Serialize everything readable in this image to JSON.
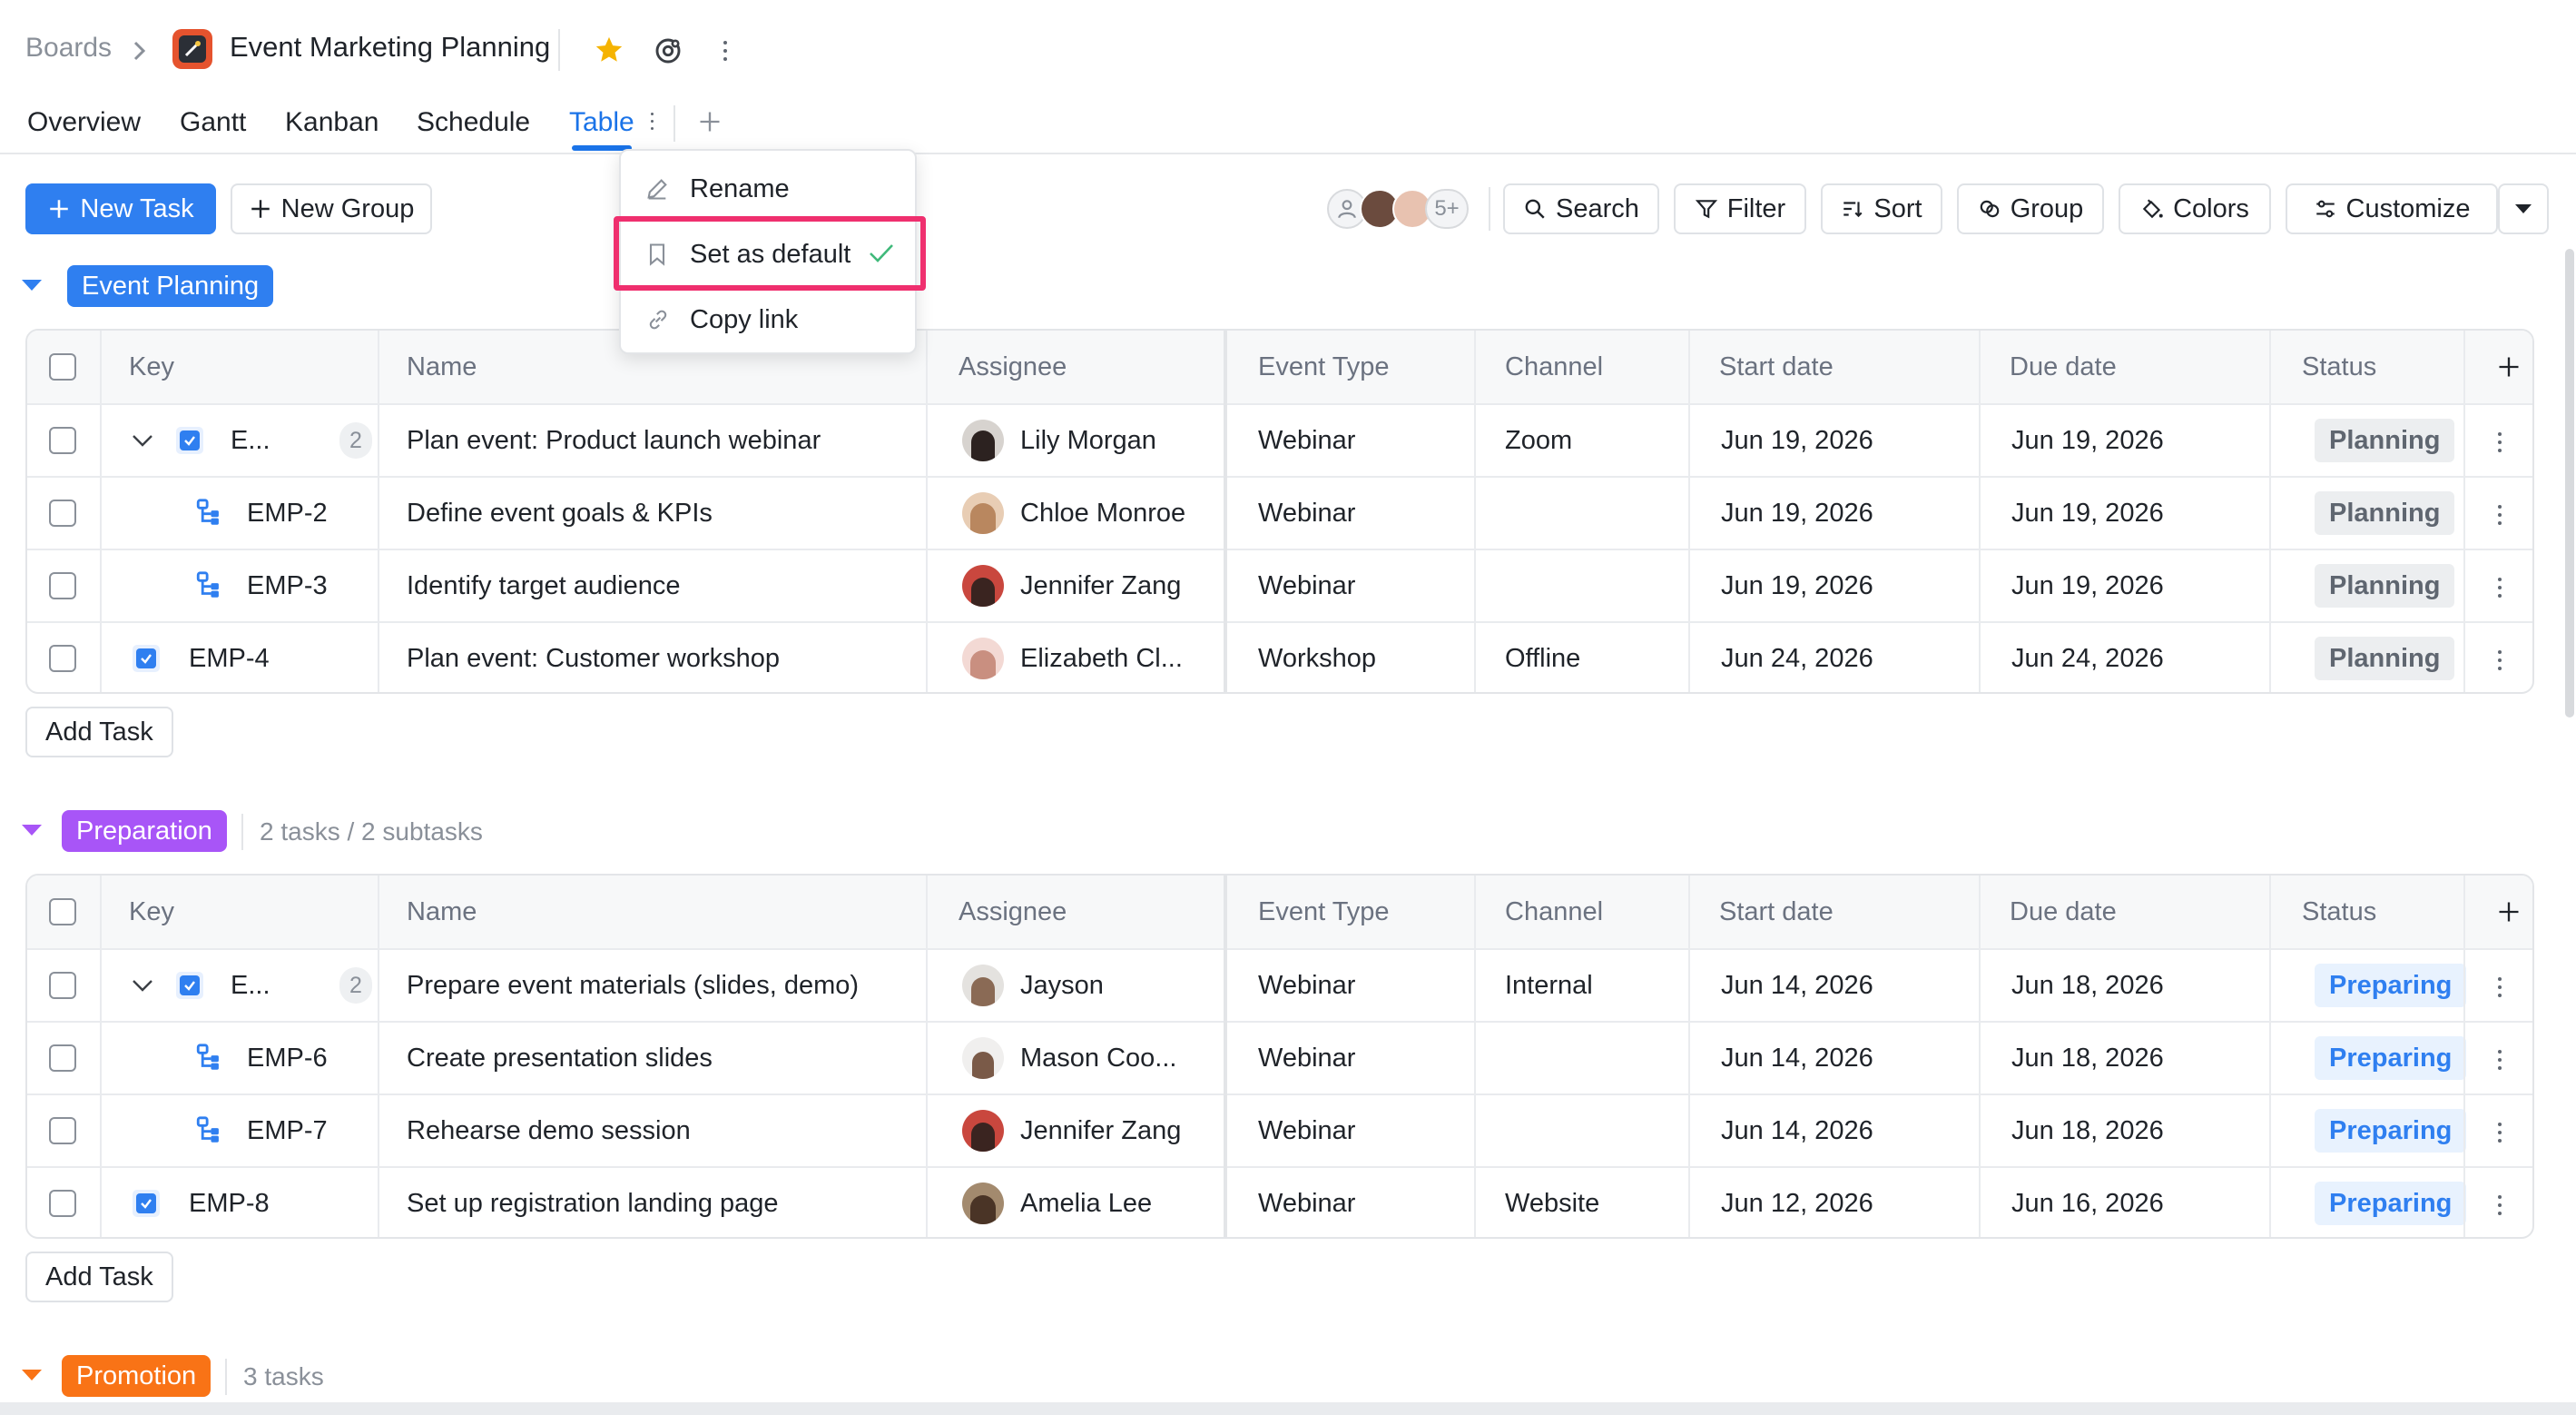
{
  "header": {
    "breadcrumb_root": "Boards",
    "board_title": "Event Marketing Planning",
    "tabs": [
      {
        "label": "Overview"
      },
      {
        "label": "Gantt"
      },
      {
        "label": "Kanban"
      },
      {
        "label": "Schedule"
      },
      {
        "label": "Table",
        "active": true
      }
    ]
  },
  "menu": {
    "items": [
      {
        "label": "Rename",
        "icon": "pencil-icon"
      },
      {
        "label": "Set as default",
        "icon": "bookmark-icon",
        "checked": true
      },
      {
        "label": "Copy link",
        "icon": "link-icon"
      }
    ]
  },
  "toolbar": {
    "new_task": "New Task",
    "new_group": "New Group",
    "members_more": "5+",
    "search": "Search",
    "filter": "Filter",
    "sort": "Sort",
    "group": "Group",
    "colors": "Colors",
    "customize": "Customize"
  },
  "columns": [
    "Key",
    "Name",
    "Assignee",
    "Event Type",
    "Channel",
    "Start date",
    "Due date",
    "Status"
  ],
  "add_task_label": "Add Task",
  "colors": {
    "accent": "#2f7ff0",
    "event_planning": "#2f7ff0",
    "preparation": "#a855f7",
    "promotion": "#f97316",
    "highlight": "#ef2f6e"
  },
  "groups": [
    {
      "name": "Event Planning",
      "count": "",
      "rows": [
        {
          "key": "E...",
          "subcount": "2",
          "type": "parent",
          "name": "Plan event: Product launch webinar",
          "assignee": "Lily Morgan",
          "event_type": "Webinar",
          "channel": "Zoom",
          "start": "Jun 19, 2026",
          "due": "Jun 19, 2026",
          "status": "Planning"
        },
        {
          "key": "EMP-2",
          "type": "subtask",
          "name": "Define event goals & KPIs",
          "assignee": "Chloe Monroe",
          "event_type": "Webinar",
          "channel": "",
          "start": "Jun 19, 2026",
          "due": "Jun 19, 2026",
          "status": "Planning"
        },
        {
          "key": "EMP-3",
          "type": "subtask",
          "name": "Identify target audience",
          "assignee": "Jennifer Zang",
          "event_type": "Webinar",
          "channel": "",
          "start": "Jun 19, 2026",
          "due": "Jun 19, 2026",
          "status": "Planning"
        },
        {
          "key": "EMP-4",
          "type": "task",
          "name": "Plan event: Customer workshop",
          "assignee": "Elizabeth Cl...",
          "event_type": "Workshop",
          "channel": "Offline",
          "start": "Jun 24, 2026",
          "due": "Jun 24, 2026",
          "status": "Planning"
        }
      ]
    },
    {
      "name": "Preparation",
      "count": "2 tasks / 2 subtasks",
      "rows": [
        {
          "key": "E...",
          "subcount": "2",
          "type": "parent",
          "name": "Prepare event materials (slides, demo)",
          "assignee": "Jayson",
          "event_type": "Webinar",
          "channel": "Internal",
          "start": "Jun 14, 2026",
          "due": "Jun 18, 2026",
          "status": "Preparing"
        },
        {
          "key": "EMP-6",
          "type": "subtask",
          "name": "Create presentation slides",
          "assignee": "Mason Coo...",
          "event_type": "Webinar",
          "channel": "",
          "start": "Jun 14, 2026",
          "due": "Jun 18, 2026",
          "status": "Preparing"
        },
        {
          "key": "EMP-7",
          "type": "subtask",
          "name": "Rehearse demo session",
          "assignee": "Jennifer Zang",
          "event_type": "Webinar",
          "channel": "",
          "start": "Jun 14, 2026",
          "due": "Jun 18, 2026",
          "status": "Preparing"
        },
        {
          "key": "EMP-8",
          "type": "task",
          "name": "Set up registration landing page",
          "assignee": "Amelia Lee",
          "event_type": "Webinar",
          "channel": "Website",
          "start": "Jun 12, 2026",
          "due": "Jun 16, 2026",
          "status": "Preparing"
        }
      ]
    },
    {
      "name": "Promotion",
      "count": "3 tasks",
      "rows": []
    }
  ]
}
